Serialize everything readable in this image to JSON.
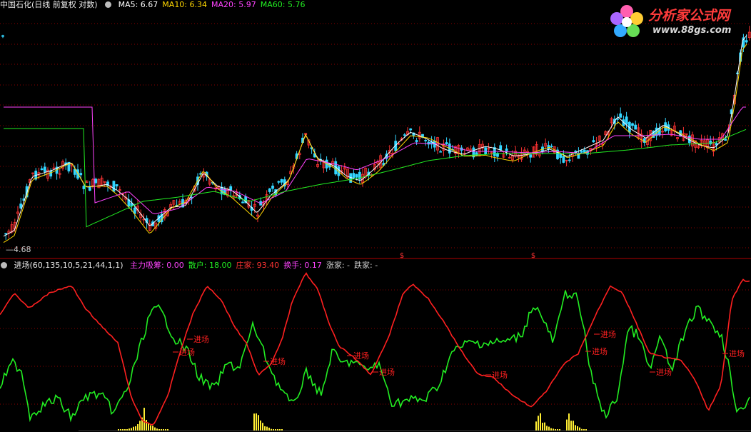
{
  "main": {
    "stock_title": "中国石化(日线 前复权 对数)",
    "ma_labels": [
      {
        "text": "MA5: 6.67",
        "color": "#ffffff"
      },
      {
        "text": "MA10: 6.34",
        "color": "#ffd700"
      },
      {
        "text": "MA20: 5.97",
        "color": "#ff44ff"
      },
      {
        "text": "MA60: 5.76",
        "color": "#22ee22"
      }
    ],
    "low_price_label": "4.68",
    "event_marker": "$"
  },
  "indicator": {
    "name": "进场(60,135,10,5,21,44,1,1)",
    "values": [
      {
        "label": "主力吸筹: 0.00",
        "color": "#ff44ff"
      },
      {
        "label": "散户: 18.00",
        "color": "#22ee22"
      },
      {
        "label": "庄家: 93.40",
        "color": "#ff3333"
      },
      {
        "label": "换手: 0.17",
        "color": "#ff44ff"
      },
      {
        "label": "涨家: -",
        "color": "#cccccc"
      },
      {
        "label": "跌家: -",
        "color": "#cccccc"
      }
    ],
    "signal_label": "进场"
  },
  "logo": {
    "brand": "分析家公式网",
    "url": "www.88gs.com"
  },
  "colors": {
    "background": "#000000",
    "grid": "#8b0000",
    "up_candle": "#ff3333",
    "down_candle": "#33d6ff",
    "retail_line": "#22ee22",
    "dealer_line": "#ff2020",
    "accumulation_bars": "#ffee33"
  }
}
